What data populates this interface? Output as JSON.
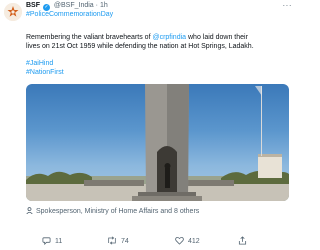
{
  "account": {
    "name": "BSF",
    "handle": "@BSF_India",
    "separator": "·",
    "time": "1h"
  },
  "tweet": {
    "hashtag_top": "#PoliceCommemorationDay",
    "text_part1": "Remembering the valiant bravehearts of ",
    "mention": "@crpfindia",
    "text_part2": " who laid down their",
    "line2": "lives on 21st Oct 1959 while defending the nation at Hot Springs, Ladakh.",
    "hashtag1": "#JaiHind",
    "hashtag2": "#NationFirst"
  },
  "media": {
    "tagged": "Spokesperson, Ministry of Home Affairs and 8 others"
  },
  "actions": {
    "replies": "11",
    "retweets": "74",
    "likes": "412"
  },
  "icons": [
    "bsf-logo-icon",
    "verified-badge-icon",
    "more-options-icon",
    "person-tag-icon",
    "reply-icon",
    "retweet-icon",
    "like-icon",
    "share-icon"
  ],
  "colors": {
    "link": "#1d9bf0",
    "text": "#0f1419",
    "muted": "#536471",
    "sky": "#4a89c7"
  }
}
